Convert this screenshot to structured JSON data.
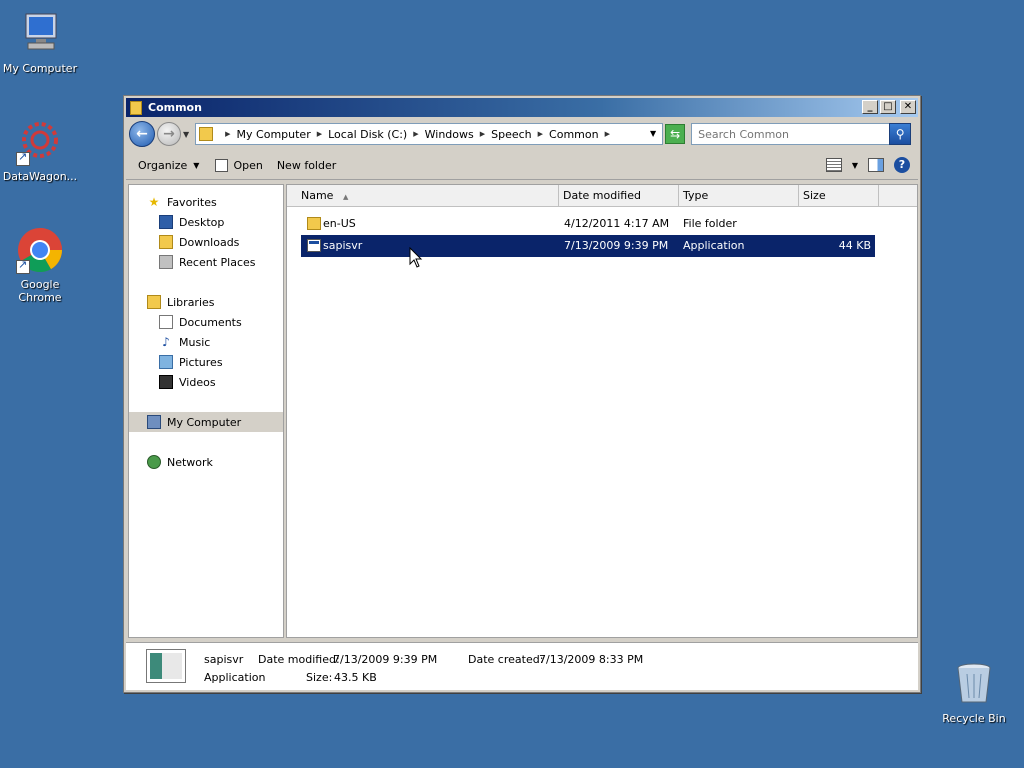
{
  "desktop": {
    "icons": [
      {
        "label": "My Computer"
      },
      {
        "label": "DataWagon..."
      },
      {
        "label": "Google Chrome"
      },
      {
        "label": "Recycle Bin"
      }
    ]
  },
  "window": {
    "title": "Common",
    "controls": {
      "minimize": "_",
      "maximize": "□",
      "close": "✕"
    }
  },
  "address": {
    "crumbs": [
      "My Computer",
      "Local Disk (C:)",
      "Windows",
      "Speech",
      "Common"
    ],
    "search_placeholder": "Search Common"
  },
  "toolbar": {
    "organize": "Organize",
    "open": "Open",
    "new_folder": "New folder"
  },
  "navpane": {
    "favorites": "Favorites",
    "desktop": "Desktop",
    "downloads": "Downloads",
    "recent_places": "Recent Places",
    "libraries": "Libraries",
    "documents": "Documents",
    "music": "Music",
    "pictures": "Pictures",
    "videos": "Videos",
    "my_computer": "My Computer",
    "network": "Network"
  },
  "filelist": {
    "columns": {
      "name": "Name",
      "date": "Date modified",
      "type": "Type",
      "size": "Size"
    },
    "rows": [
      {
        "name": "en-US",
        "date": "4/12/2011 4:17 AM",
        "type": "File folder",
        "size": ""
      },
      {
        "name": "sapisvr",
        "date": "7/13/2009 9:39 PM",
        "type": "Application",
        "size": "44 KB"
      }
    ]
  },
  "details": {
    "name": "sapisvr",
    "type": "Application",
    "date_modified_label": "Date modified:",
    "date_modified": "7/13/2009 9:39 PM",
    "date_created_label": "Date created:",
    "date_created": "7/13/2009 8:33 PM",
    "size_label": "Size:",
    "size": "43.5 KB"
  }
}
